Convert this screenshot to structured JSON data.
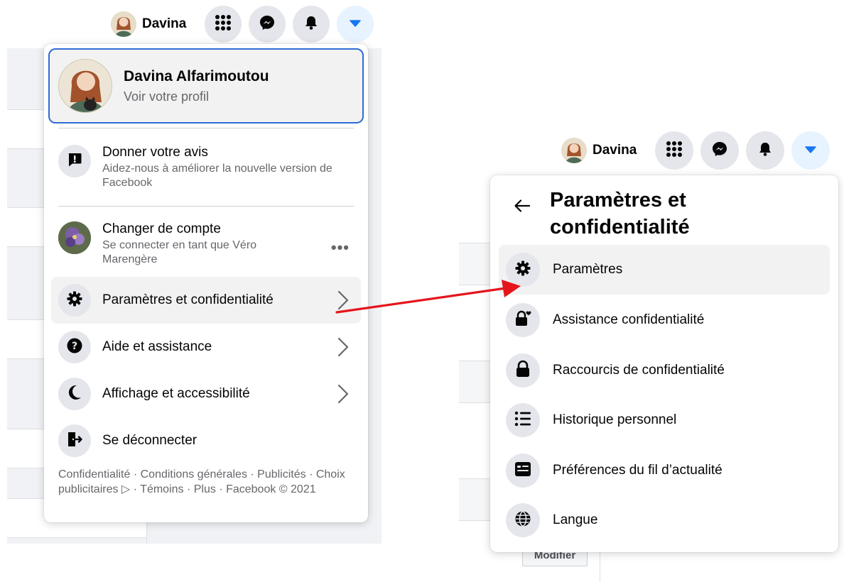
{
  "topbar": {
    "user_name": "Davina",
    "icons": [
      "menu-grid-icon",
      "messenger-icon",
      "bell-icon",
      "caret-down-icon"
    ]
  },
  "left_menu": {
    "profile": {
      "name": "Davina Alfarimoutou",
      "subtitle": "Voir votre profil"
    },
    "feedback": {
      "title": "Donner votre avis",
      "subtitle": "Aidez-nous à améliorer la nouvelle version de Facebook"
    },
    "switch_account": {
      "title": "Changer de compte",
      "subtitle": "Se connecter en tant que Véro Marengère",
      "more": "•••"
    },
    "items": [
      {
        "label": "Paramètres et confidentialité",
        "icon": "gear-icon"
      },
      {
        "label": "Aide et assistance",
        "icon": "question-icon"
      },
      {
        "label": "Affichage et accessibilité",
        "icon": "moon-icon"
      },
      {
        "label": "Se déconnecter",
        "icon": "logout-icon"
      }
    ],
    "footer": "Confidentialité · Conditions générales · Publicités · Choix publicitaires ▷ · Témoins · Plus · Facebook © 2021"
  },
  "right_menu": {
    "title": "Paramètres et confidentialité",
    "items": [
      {
        "label": "Paramètres",
        "icon": "gear-icon"
      },
      {
        "label": "Assistance confidentialité",
        "icon": "lock-heart-icon"
      },
      {
        "label": "Raccourcis de confidentialité",
        "icon": "lock-icon"
      },
      {
        "label": "Historique personnel",
        "icon": "list-icon"
      },
      {
        "label": "Préférences du fil d’actualité",
        "icon": "feed-icon"
      },
      {
        "label": "Langue",
        "icon": "globe-icon"
      }
    ]
  },
  "background": {
    "modify_button": "Modifier"
  },
  "colors": {
    "focus_blue": "#2e6bd6",
    "annotation_arrow": "#e4151b",
    "fb_blue": "#1877f2",
    "hover_gray": "#f2f2f2",
    "icon_gray": "#e4e6eb"
  }
}
